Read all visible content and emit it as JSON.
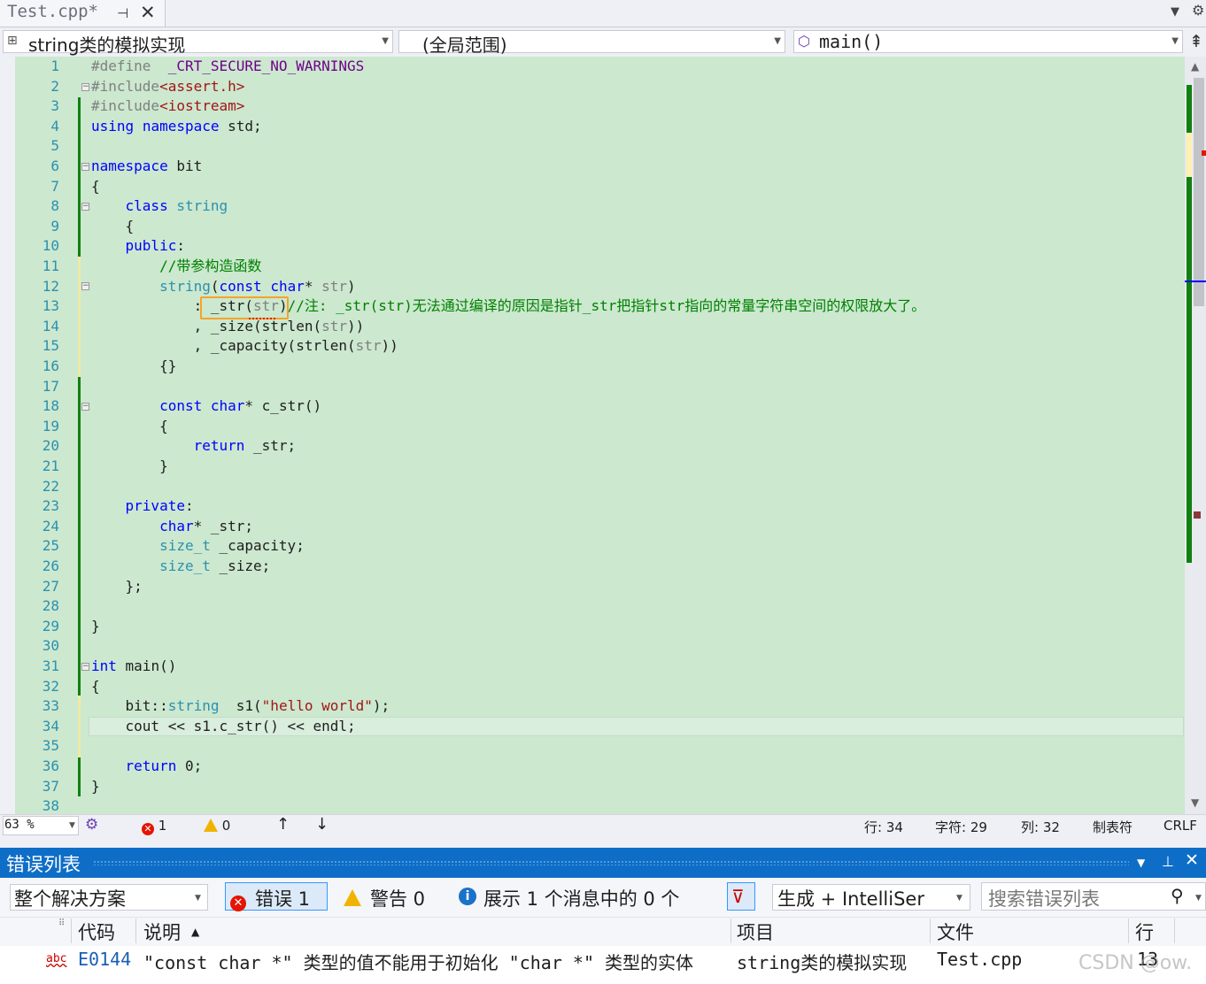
{
  "tab": {
    "label": "Test.cpp*",
    "pin": "⊣",
    "close": "✕"
  },
  "nav": {
    "project": "string类的模拟实现",
    "scope": "(全局范围)",
    "member": "main()"
  },
  "lines": [
    {
      "n": "1",
      "html": "<span class='pp'>#define</span>  <span class='mc'>_CRT_SECURE_NO_WARNINGS</span>"
    },
    {
      "n": "2",
      "html": "<span class='pp'>#include</span><span class='st'>&lt;assert.h&gt;</span>"
    },
    {
      "n": "3",
      "html": "<span class='pp'>#include</span><span class='st'>&lt;iostream&gt;</span>"
    },
    {
      "n": "4",
      "html": "<span class='kw'>using</span> <span class='kw'>namespace</span> std;"
    },
    {
      "n": "5",
      "html": ""
    },
    {
      "n": "6",
      "html": "<span class='kw'>namespace</span> bit"
    },
    {
      "n": "7",
      "html": "{"
    },
    {
      "n": "8",
      "html": "    <span class='kw'>class</span> <span class='ty'>string</span>"
    },
    {
      "n": "9",
      "html": "    {"
    },
    {
      "n": "10",
      "html": "    <span class='kw'>public</span>:"
    },
    {
      "n": "11",
      "html": "        <span class='cm'>//带参构造函数</span>"
    },
    {
      "n": "12",
      "html": "        <span class='ty'>string</span>(<span class='kw'>const</span> <span class='kw'>char</span>* <span class='pr'>str</span>)"
    },
    {
      "n": "13",
      "html": "            : _str(<span class='pr'>str</span>)<span class='cm'>//注: _str(str)无法通过编译的原因是指针_str把指针str指向的常量字符串空间的权限放大了。</span>"
    },
    {
      "n": "14",
      "html": "            , _size(strlen(<span class='pr'>str</span>))"
    },
    {
      "n": "15",
      "html": "            , _capacity(strlen(<span class='pr'>str</span>))"
    },
    {
      "n": "16",
      "html": "        {}"
    },
    {
      "n": "17",
      "html": ""
    },
    {
      "n": "18",
      "html": "        <span class='kw'>const</span> <span class='kw'>char</span>* c_str()"
    },
    {
      "n": "19",
      "html": "        {"
    },
    {
      "n": "20",
      "html": "            <span class='kw'>return</span> _str;"
    },
    {
      "n": "21",
      "html": "        }"
    },
    {
      "n": "22",
      "html": ""
    },
    {
      "n": "23",
      "html": "    <span class='kw'>private</span>:"
    },
    {
      "n": "24",
      "html": "        <span class='kw'>char</span>* _str;"
    },
    {
      "n": "25",
      "html": "        <span class='ty'>size_t</span> _capacity;"
    },
    {
      "n": "26",
      "html": "        <span class='ty'>size_t</span> _size;"
    },
    {
      "n": "27",
      "html": "    };"
    },
    {
      "n": "28",
      "html": ""
    },
    {
      "n": "29",
      "html": "}"
    },
    {
      "n": "30",
      "html": ""
    },
    {
      "n": "31",
      "html": "<span class='kw'>int</span> main()"
    },
    {
      "n": "32",
      "html": "{"
    },
    {
      "n": "33",
      "html": "    bit::<span class='ty'>string</span>  s1(<span class='st'>\"hello world\"</span>);"
    },
    {
      "n": "34",
      "html": "    cout &lt;&lt; s1.c_str() &lt;&lt; endl;"
    },
    {
      "n": "35",
      "html": ""
    },
    {
      "n": "36",
      "html": "    <span class='kw'>return</span> 0;"
    },
    {
      "n": "37",
      "html": "}"
    },
    {
      "n": "38",
      "html": ""
    }
  ],
  "status": {
    "zoom": "63 %",
    "errors": "1",
    "warnings": "0",
    "line": "行: 34",
    "char": "字符: 29",
    "col": "列: 32",
    "tabs": "制表符",
    "eol": "CRLF"
  },
  "error_list": {
    "title": "错误列表",
    "scope": "整个解决方案",
    "errors_label": "错误 1",
    "warnings_label": "警告 0",
    "messages_label": "展示 1 个消息中的 0 个",
    "build_filter": "生成 + IntelliSer",
    "search_placeholder": "搜索错误列表",
    "columns": {
      "code": "代码",
      "description": "说明",
      "project": "项目",
      "file": "文件",
      "line": "行"
    },
    "rows": [
      {
        "code": "E0144",
        "description": "\"const char *\" 类型的值不能用于初始化 \"char *\" 类型的实体",
        "project": "string类的模拟实现",
        "file": "Test.cpp",
        "line": "13"
      }
    ]
  },
  "watermark": "CSDN @ow."
}
